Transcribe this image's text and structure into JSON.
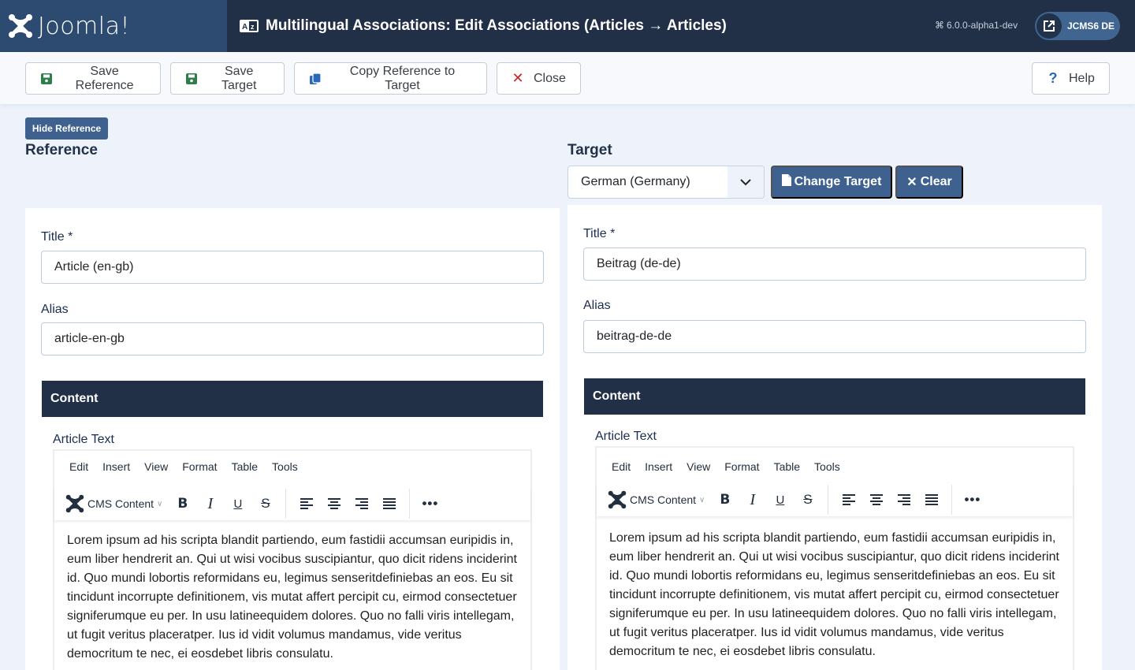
{
  "header": {
    "brand": "Joomla!",
    "title": "Multilingual Associations: Edit Associations (Articles → Articles)",
    "title_icon": "language-icon",
    "version": "6.0.0-alpha1-dev",
    "site_link_label": "JCMS6 DE",
    "colors": {
      "header_bg": "#212f47",
      "logo_bg": "#2d4a70",
      "pill_bg": "#3f6590"
    }
  },
  "toolbar": {
    "save_reference": "Save Reference",
    "save_target": "Save Target",
    "copy_reference": "Copy Reference to Target",
    "close": "Close",
    "help": "Help"
  },
  "reference": {
    "hide_button": "Hide Reference",
    "heading": "Reference",
    "title_label": "Title *",
    "title_value": "Article (en-gb)",
    "alias_label": "Alias",
    "alias_value": "article-en-gb",
    "content_tab": "Content",
    "article_text_label": "Article Text"
  },
  "target": {
    "heading": "Target",
    "language_selected": "German (Germany)",
    "change_target": "Change Target",
    "clear": "Clear",
    "title_label": "Title *",
    "title_value": "Beitrag (de-de)",
    "alias_label": "Alias",
    "alias_value": "beitrag-de-de",
    "content_tab": "Content",
    "article_text_label": "Article Text"
  },
  "editor": {
    "menus": [
      "Edit",
      "Insert",
      "View",
      "Format",
      "Table",
      "Tools"
    ],
    "cms_content": "CMS Content",
    "tools": [
      "bold",
      "italic",
      "underline",
      "strikethrough",
      "align-left",
      "align-center",
      "align-right",
      "justify",
      "more"
    ],
    "body_lines": [
      "Lorem ipsum ad his scripta blandit partiendo, eum fastidii accumsan euripidis in,",
      "eum liber hendrerit an. Qui ut wisi vocibus suscipiantur, quo dicit ridens inciderint",
      "id. Quo mundi lobortis reformidans eu, legimus senseritdefiniebas an eos. Eu sit",
      "tincidunt incorrupte definitionem, vis mutat affert percipit cu, eirmod consectetuer",
      "signiferumque eu per. In usu latineequidem dolores. Quo no falli viris intellegam,",
      "ut fugit veritus placeratper. Ius id vidit volumus mandamus, vide veritus",
      "democritum te nec, ei eosdebet libris consulatu."
    ]
  }
}
